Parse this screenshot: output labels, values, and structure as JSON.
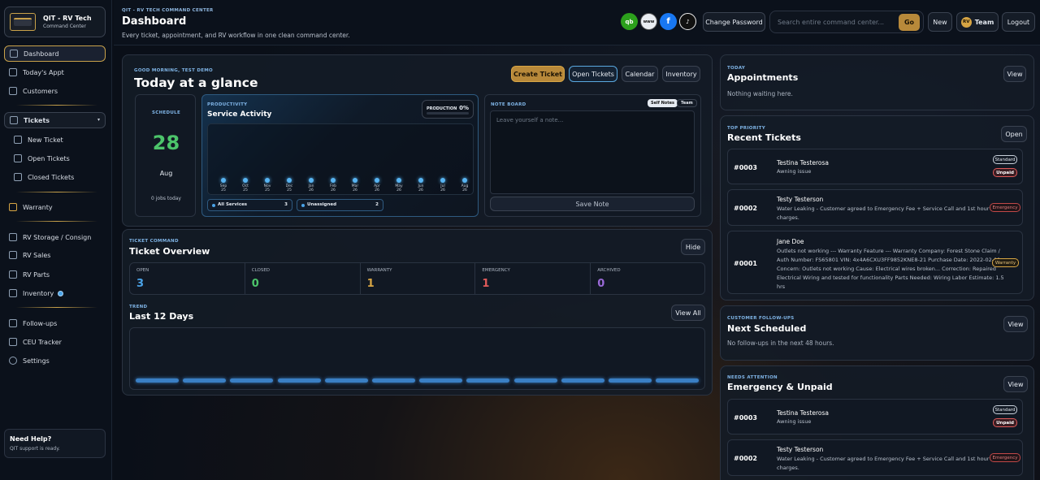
{
  "brand": {
    "name": "QIT - RV Tech",
    "subtitle": "Command Center"
  },
  "sidebar": {
    "items": [
      {
        "label": "Dashboard"
      },
      {
        "label": "Today's Appt"
      },
      {
        "label": "Customers"
      },
      {
        "label": "Tickets"
      },
      {
        "label": "New Ticket"
      },
      {
        "label": "Open Tickets"
      },
      {
        "label": "Closed Tickets"
      },
      {
        "label": "Warranty"
      },
      {
        "label": "RV Storage / Consign"
      },
      {
        "label": "RV Sales"
      },
      {
        "label": "RV Parts"
      },
      {
        "label": "Inventory"
      },
      {
        "label": "Follow-ups"
      },
      {
        "label": "CEU Tracker"
      },
      {
        "label": "Settings"
      }
    ],
    "help": {
      "title": "Need Help?",
      "text": "QIT support is ready."
    }
  },
  "header": {
    "kicker": "QIT - RV TECH COMMAND CENTER",
    "title": "Dashboard",
    "subtitle": "Every ticket, appointment, and RV workflow in one clean command center.",
    "icons": {
      "qb": "qb",
      "www": "www"
    },
    "change_password": "Change Password",
    "search_placeholder": "Search entire command center...",
    "go": "Go",
    "new": "New",
    "team_badge": "RV",
    "team": "Team",
    "logout": "Logout"
  },
  "glance": {
    "kicker": "GOOD MORNING, TEST DEMO",
    "title": "Today at a glance",
    "buttons": {
      "create": "Create Ticket",
      "open": "Open Tickets",
      "calendar": "Calendar",
      "inventory": "Inventory"
    },
    "schedule": {
      "kicker": "SCHEDULE",
      "day": "28",
      "month": "Aug",
      "jobs": "0 jobs today"
    },
    "productivity": {
      "kicker": "PRODUCTIVITY",
      "title": "Service Activity",
      "production_label": "PRODUCTION",
      "production_value": "0%",
      "months": [
        {
          "m": "Sep",
          "y": "25"
        },
        {
          "m": "Oct",
          "y": "25"
        },
        {
          "m": "Nov",
          "y": "25"
        },
        {
          "m": "Dec",
          "y": "25"
        },
        {
          "m": "Jan",
          "y": "26"
        },
        {
          "m": "Feb",
          "y": "26"
        },
        {
          "m": "Mar",
          "y": "26"
        },
        {
          "m": "Apr",
          "y": "26"
        },
        {
          "m": "May",
          "y": "26"
        },
        {
          "m": "Jun",
          "y": "26"
        },
        {
          "m": "Jul",
          "y": "26"
        },
        {
          "m": "Aug",
          "y": "26"
        }
      ],
      "chip1": {
        "label": "All Services",
        "value": "3"
      },
      "chip2": {
        "label": "Unassigned",
        "value": "2"
      }
    },
    "notes": {
      "kicker": "NOTE BOARD",
      "tab1": "Self Notes",
      "tab2": "Team",
      "placeholder": "Leave yourself a note...",
      "save": "Save Note"
    }
  },
  "overview": {
    "kicker": "TICKET COMMAND",
    "title": "Ticket Overview",
    "hide": "Hide",
    "stats": [
      {
        "label": "OPEN",
        "value": "3",
        "color": "#4aa3e8"
      },
      {
        "label": "CLOSED",
        "value": "0",
        "color": "#4cc46a"
      },
      {
        "label": "WARRANTY",
        "value": "1",
        "color": "#d7a544"
      },
      {
        "label": "EMERGENCY",
        "value": "1",
        "color": "#e05a5a"
      },
      {
        "label": "ARCHIVED",
        "value": "0",
        "color": "#9a6ad8"
      }
    ]
  },
  "trend": {
    "kicker": "TREND",
    "title": "Last 12 Days",
    "view_all": "View All",
    "bars": 12
  },
  "appointments": {
    "kicker": "TODAY",
    "title": "Appointments",
    "view": "View",
    "empty": "Nothing waiting here."
  },
  "recent": {
    "kicker": "TOP PRIORITY",
    "title": "Recent Tickets",
    "open": "Open",
    "tickets": [
      {
        "num": "#0003",
        "name": "Testina Testerosa",
        "desc": "Awning issue",
        "pill1": "Standard",
        "pill2": "Unpaid"
      },
      {
        "num": "#0002",
        "name": "Testy Testerson",
        "desc1": "Water Leaking - Customer agreed to Emergency Fee + Service Call and 1st hour",
        "desc2": "charges.",
        "pill1": "Emergency"
      },
      {
        "num": "#0001",
        "name": "Jane Doe",
        "desc1": "Outlets not working --- Warranty Feature --- Warranty Company: Forest Stone Claim /",
        "desc2": "Auth Number: FS65801 VIN: 4x4A6CXU3FF9852KNE8-21 Purchase Date: 2022-02-01",
        "desc3": "Concern: Outlets not working Cause: Electrical wires broken... Correction: Repaired",
        "desc4": "Electrical Wiring and tested for functionality Parts Needed: Wiring Labor Estimate: 1.5",
        "desc5": "hrs",
        "pill1": "Warranty"
      }
    ]
  },
  "followups": {
    "kicker": "CUSTOMER FOLLOW-UPS",
    "title": "Next Scheduled",
    "view": "View",
    "empty": "No follow-ups in the next 48 hours."
  },
  "emergency": {
    "kicker": "NEEDS ATTENTION",
    "title": "Emergency & Unpaid",
    "view": "View",
    "tickets": [
      {
        "num": "#0003",
        "name": "Testina Testerosa",
        "desc": "Awning issue",
        "pill1": "Standard",
        "pill2": "Unpaid"
      },
      {
        "num": "#0002",
        "name": "Testy Testerson",
        "desc1": "Water Leaking - Customer agreed to Emergency Fee + Service Call and 1st hour",
        "desc2": "charges.",
        "pill1": "Emergency"
      }
    ]
  }
}
